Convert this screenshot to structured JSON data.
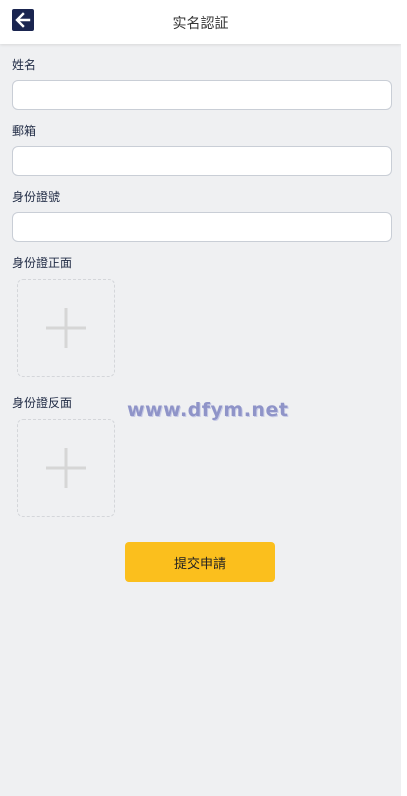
{
  "header": {
    "title": "实名認証",
    "back_icon": "back-arrow-icon"
  },
  "form": {
    "fields": [
      {
        "label": "姓名",
        "value": "",
        "placeholder": ""
      },
      {
        "label": "郵箱",
        "value": "",
        "placeholder": ""
      },
      {
        "label": "身份證號",
        "value": "",
        "placeholder": ""
      }
    ],
    "uploads": [
      {
        "label": "身份證正面",
        "icon": "plus-icon"
      },
      {
        "label": "身份證反面",
        "icon": "plus-icon"
      }
    ],
    "submit_label": "提交申請"
  },
  "watermark": "www.dfym.net",
  "colors": {
    "accent": "#fbbf1d",
    "back_button": "#1a2550",
    "background": "#eff0f2"
  }
}
